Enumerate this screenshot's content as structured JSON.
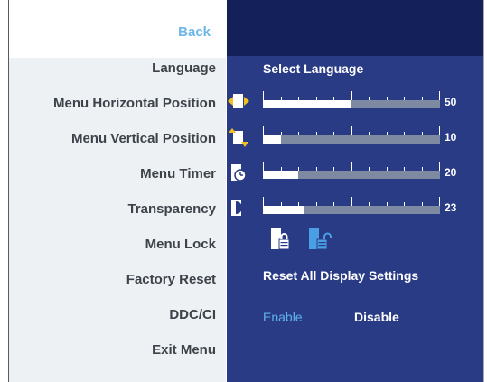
{
  "menu": {
    "back_label": "Back",
    "items": [
      {
        "label": "Language"
      },
      {
        "label": "Menu Horizontal Position"
      },
      {
        "label": "Menu Vertical Position"
      },
      {
        "label": "Menu Timer"
      },
      {
        "label": "Transparency"
      },
      {
        "label": "Menu Lock"
      },
      {
        "label": "Factory Reset"
      },
      {
        "label": "DDC/CI"
      },
      {
        "label": "Exit Menu"
      }
    ]
  },
  "settings": {
    "language": {
      "value": "Select Language"
    },
    "horizontal_position": {
      "value": "50",
      "level": 0.5,
      "icon": "horizontal-position-icon"
    },
    "vertical_position": {
      "value": "10",
      "level": 0.1,
      "icon": "vertical-position-icon"
    },
    "menu_timer": {
      "value": "20",
      "level": 0.2,
      "icon": "timer-icon"
    },
    "transparency": {
      "value": "23",
      "level": 0.23,
      "icon": "transparency-icon"
    },
    "menu_lock": {
      "icons": [
        "locked-icon",
        "unlocked-icon"
      ]
    },
    "factory_reset": {
      "label": "Reset All Display Settings"
    },
    "ddc_ci": {
      "enable_label": "Enable",
      "disable_label": "Disable"
    }
  },
  "colors": {
    "accent": "#6cb6ea",
    "panel_blue": "#2a3b86",
    "panel_dark": "#14205a"
  }
}
